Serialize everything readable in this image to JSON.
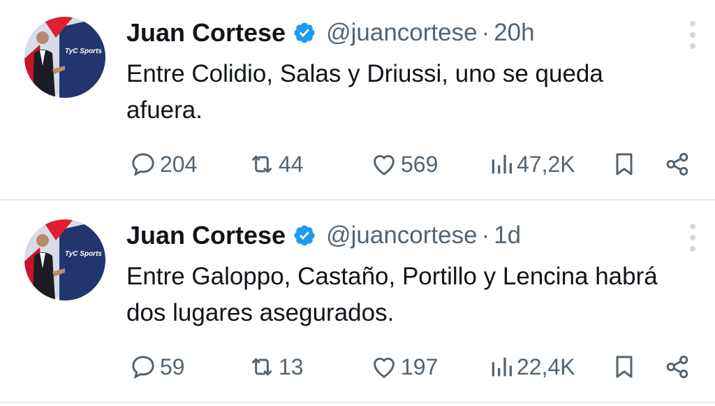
{
  "tweets": [
    {
      "author_name": "Juan Cortese",
      "handle": "@juancortese",
      "separator": "·",
      "time": "20h",
      "text": "Entre Colidio, Salas y Driussi, uno se queda afuera.",
      "avatar_logo_text": "TyC Sports",
      "replies": "204",
      "retweets": "44",
      "likes": "569",
      "views": "47,2K"
    },
    {
      "author_name": "Juan Cortese",
      "handle": "@juancortese",
      "separator": "·",
      "time": "1d",
      "text": "Entre Galoppo, Castaño, Portillo y Lencina habrá dos lugares asegurados.",
      "avatar_logo_text": "TyC Sports",
      "replies": "59",
      "retweets": "13",
      "likes": "197",
      "views": "22,4K"
    }
  ],
  "icons": {
    "reply": "reply-icon",
    "retweet": "retweet-icon",
    "like": "heart-icon",
    "views": "views-icon",
    "bookmark": "bookmark-icon",
    "share": "share-icon",
    "verified": "verified-badge-icon",
    "more": "more-vertical-icon"
  },
  "colors": {
    "text": "#0f1419",
    "secondary": "#536471",
    "verified": "#1d9bf0",
    "divider": "#e7e9ea"
  }
}
